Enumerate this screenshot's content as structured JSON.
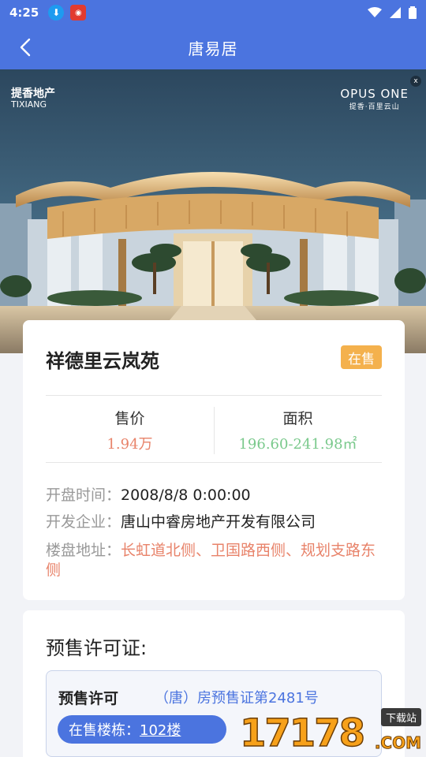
{
  "status_bar": {
    "time": "4:25"
  },
  "app_bar": {
    "title": "唐易居"
  },
  "hero": {
    "logo_left_line1": "提香地产",
    "logo_left_line2": "TIXIANG",
    "logo_right_line1": "OPUS ONE",
    "logo_right_line2": "提香·百里云山"
  },
  "project": {
    "name": "祥德里云岚苑",
    "status": "在售",
    "price_label": "售价",
    "price_value": "1.94万",
    "area_label": "面积",
    "area_value": "196.60-241.98㎡",
    "open_time_label": "开盘时间：",
    "open_time_value": "2008/8/8 0:00:00",
    "developer_label": "开发企业：",
    "developer_value": "唐山中睿房地产开发有限公司",
    "address_label": "楼盘地址：",
    "address_value": "长虹道北侧、卫国路西侧、规划支路东侧"
  },
  "permit": {
    "heading": "预售许可证:",
    "item_title": "预售许可",
    "item_number": "（唐）房预售证第2481号",
    "buildings_label": "在售楼栋：",
    "buildings_value": "102楼"
  },
  "watermark": {
    "digits": "17178",
    "tag": "下载站",
    "suffix": ".COM"
  },
  "colors": {
    "primary": "#4b74df",
    "accent_orange": "#f4b14d",
    "price": "#e8836a",
    "area": "#7ac98c"
  }
}
